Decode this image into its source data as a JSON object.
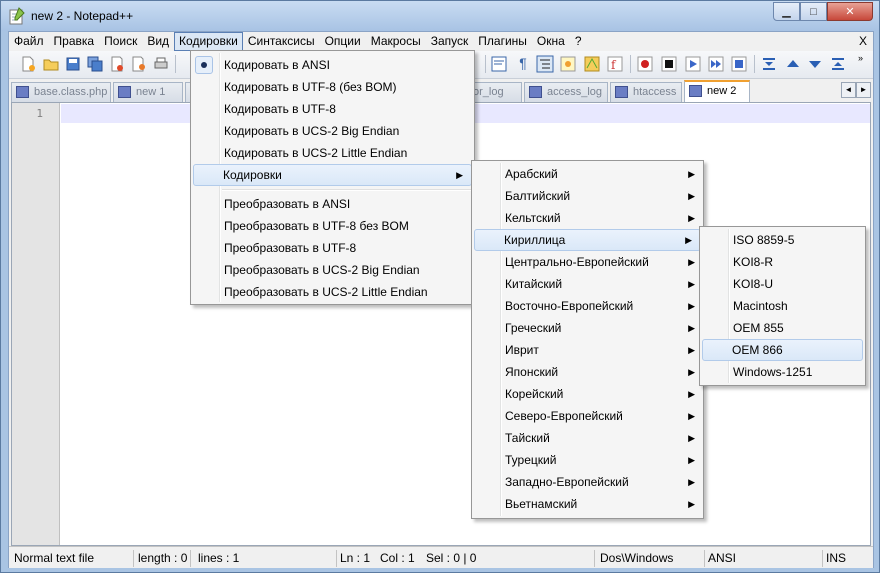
{
  "window": {
    "title": "new  2 - Notepad++",
    "minimize": "▁",
    "maximize": "□",
    "close": "✕"
  },
  "menubar": {
    "items": [
      "Файл",
      "Правка",
      "Поиск",
      "Вид",
      "Кодировки",
      "Синтаксисы",
      "Опции",
      "Макросы",
      "Запуск",
      "Плагины",
      "Окна",
      "?"
    ],
    "close_doc": "X"
  },
  "tabs": [
    {
      "label": "base.class.php"
    },
    {
      "label": "new  1"
    },
    {
      "label": "or_log"
    },
    {
      "label": "access_log"
    },
    {
      "label": "htaccess"
    },
    {
      "label": "new  2"
    }
  ],
  "tab_nav": {
    "left": "◄",
    "right": "►"
  },
  "editor": {
    "line_number": "1"
  },
  "encoding_menu": {
    "items": [
      "Кодировать в ANSI",
      "Кодировать в UTF-8 (без BOM)",
      "Кодировать в UTF-8",
      "Кодировать в UCS-2 Big Endian",
      "Кодировать в UCS-2 Little Endian",
      "Кодировки",
      "Преобразовать в ANSI",
      "Преобразовать в UTF-8 без BOM",
      "Преобразовать в UTF-8",
      "Преобразовать в UCS-2 Big Endian",
      "Преобразовать в UCS-2 Little Endian"
    ],
    "checked": "Кодировать в ANSI",
    "highlighted": "Кодировки"
  },
  "charsets_menu": {
    "items": [
      "Арабский",
      "Балтийский",
      "Кельтский",
      "Кириллица",
      "Центрально-Европейский",
      "Китайский",
      "Восточно-Европейский",
      "Греческий",
      "Иврит",
      "Японский",
      "Корейский",
      "Северо-Европейский",
      "Тайский",
      "Турецкий",
      "Западно-Европейский",
      "Вьетнамский"
    ],
    "highlighted": "Кириллица"
  },
  "cyrillic_menu": {
    "items": [
      "ISO 8859-5",
      "KOI8-R",
      "KOI8-U",
      "Macintosh",
      "OEM 855",
      "OEM 866",
      "Windows-1251"
    ],
    "highlighted": "OEM 866"
  },
  "statusbar": {
    "file_type": "Normal text file",
    "length": "length : 0",
    "lines": "lines : 1",
    "ln": "Ln : 1",
    "col": "Col : 1",
    "sel": "Sel : 0 | 0",
    "eol": "Dos\\Windows",
    "encoding": "ANSI",
    "mode": "INS"
  },
  "colors": {
    "accent": "#f0a030",
    "highlight": "#dae8f8",
    "current_line": "#e8e8ff"
  }
}
